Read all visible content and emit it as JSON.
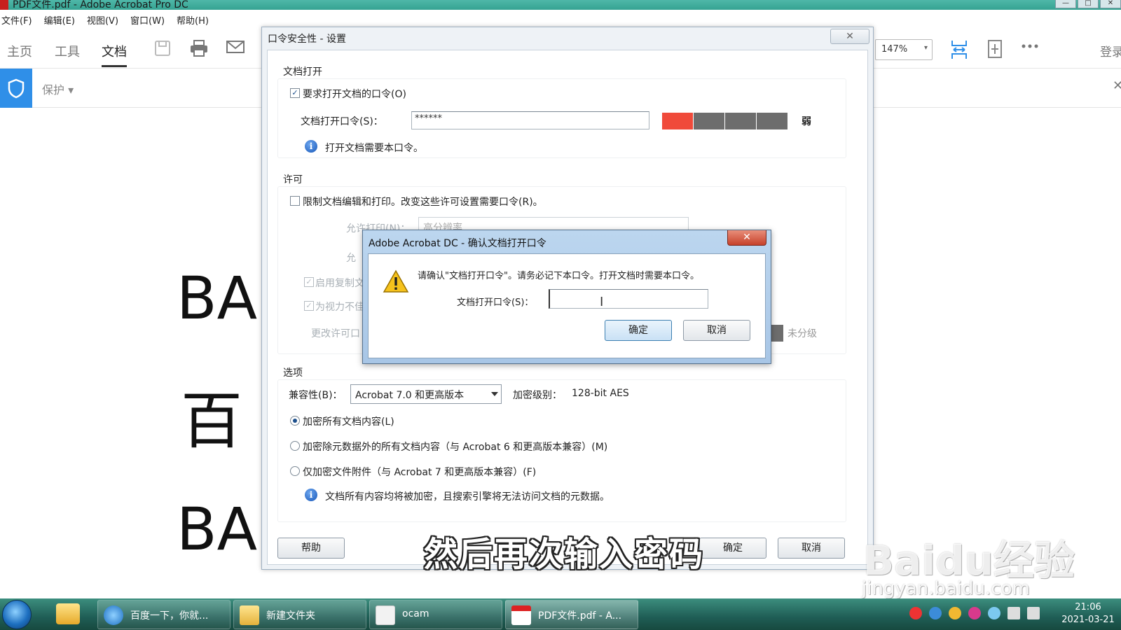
{
  "window": {
    "title": "PDF文件.pdf - Adobe Acrobat Pro DC",
    "controls": [
      "—",
      "□",
      "✕"
    ]
  },
  "menu": [
    "文件(F)",
    "编辑(E)",
    "视图(V)",
    "窗口(W)",
    "帮助(H)"
  ],
  "toolbar": {
    "tabs": [
      "主页",
      "工具",
      "文档"
    ],
    "active_tab": "文档",
    "zoom": "147%",
    "login": "登录"
  },
  "protect": {
    "label": "保护 ▾"
  },
  "document": {
    "lines": [
      "BA",
      "百",
      "BA"
    ]
  },
  "password_dialog": {
    "title": "口令安全性 - 设置",
    "close": "✕",
    "open_section": {
      "title": "文档打开",
      "require_label": "要求打开文档的口令(O)",
      "password_label": "文档打开口令(S)：",
      "password_value": "******",
      "strength": "弱",
      "info": "打开文档需要本口令。"
    },
    "permissions_section": {
      "title": "许可",
      "restrict_label": "限制文档编辑和打印。改变这些许可设置需要口令(R)。",
      "print_label": "允许打印(N)：",
      "print_value": "高分辨率",
      "change_label": "允",
      "copy_label": "启用复制文",
      "vision_label": "为视力不佳",
      "change_pw_label": "更改许可口",
      "unrated": "未分级"
    },
    "options_section": {
      "title": "选项",
      "compat_label": "兼容性(B)：",
      "compat_value": "Acrobat 7.0 和更高版本",
      "level_label": "加密级别：",
      "level_value": "128-bit AES",
      "radio1": "加密所有文档内容(L)",
      "radio2": "加密除元数据外的所有文档内容（与 Acrobat 6 和更高版本兼容）(M)",
      "radio3": "仅加密文件附件（与 Acrobat 7 和更高版本兼容）(F)",
      "info": "文档所有内容均将被加密，且搜索引擎将无法访问文档的元数据。"
    },
    "help_button": "帮助",
    "ok_button": "确定",
    "cancel_button": "取消"
  },
  "confirm_dialog": {
    "title": "Adobe Acrobat DC - 确认文档打开口令",
    "close": "✕",
    "message": "请确认\"文档打开口令\"。请务必记下本口令。打开文档时需要本口令。",
    "field_label": "文档打开口令(S)：",
    "field_value": "",
    "ok": "确定",
    "cancel": "取消"
  },
  "subtitle": "然后再次输入密码",
  "watermark": {
    "main": "Baidu经验",
    "sub": "jingyan.baidu.com"
  },
  "taskbar": {
    "items": [
      "百度一下，你就...",
      "新建文件夹",
      "ocam",
      "PDF文件.pdf - A..."
    ],
    "time": "21:06",
    "date": "2021-03-21"
  },
  "colors": {
    "accent": "#2f8fe8",
    "strength_weak": "#f04a3a",
    "strength_empty": "#6d6d6d"
  }
}
